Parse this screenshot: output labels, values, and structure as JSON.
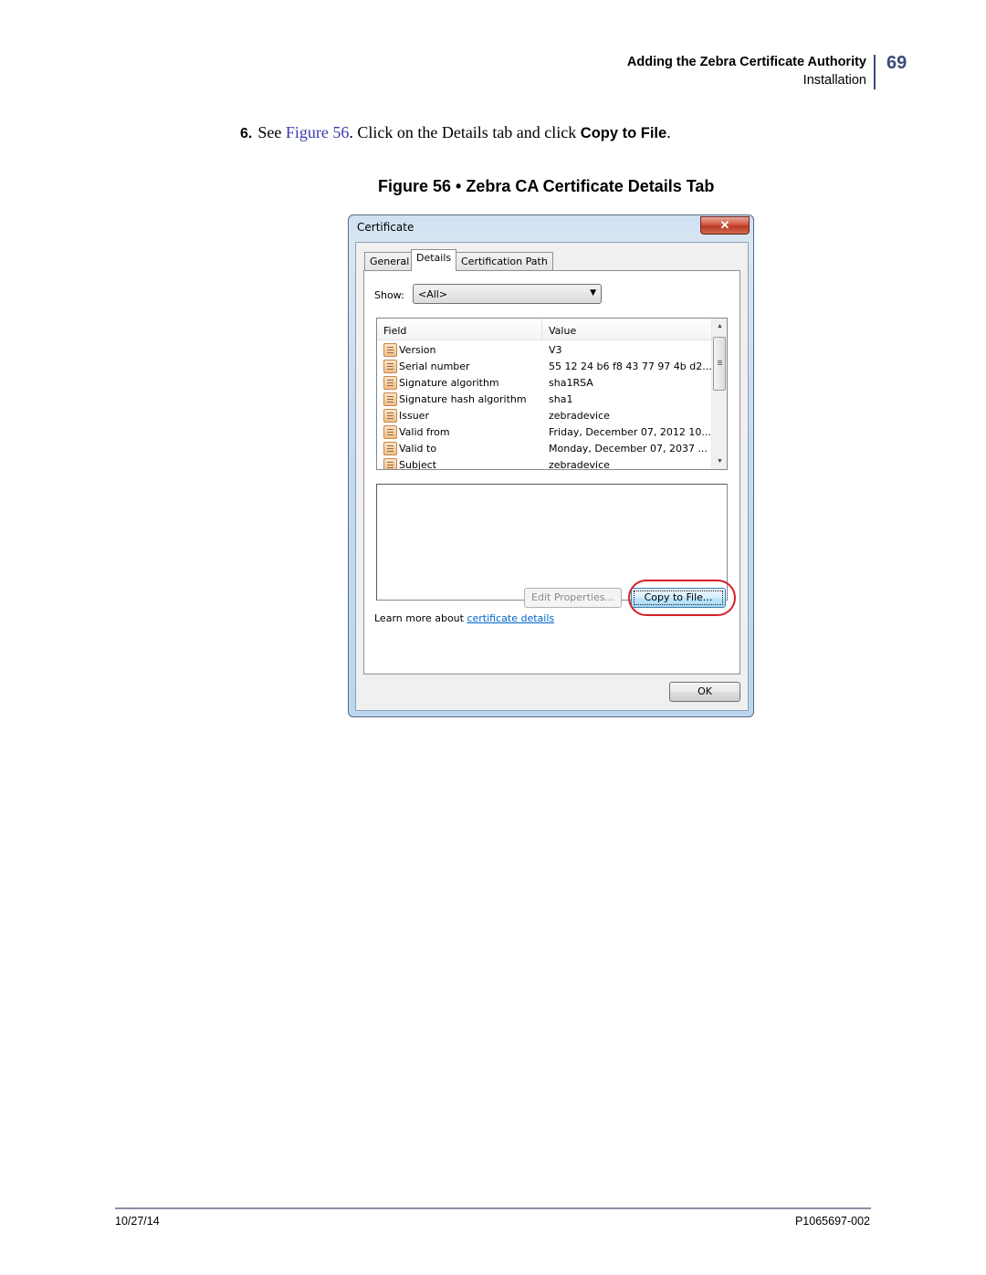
{
  "header": {
    "section_title": "Adding the Zebra Certificate Authority",
    "subsection": "Installation",
    "page_number": "69"
  },
  "step": {
    "number": "6.",
    "text_before": "See ",
    "figure_link": "Figure 56",
    "text_middle": ". Click on the Details tab and click ",
    "bold_text": "Copy to File",
    "text_after": "."
  },
  "figure_caption": "Figure 56 • Zebra CA Certificate Details Tab",
  "dialog": {
    "title": "Certificate",
    "close_glyph": "✕",
    "tabs": [
      {
        "label": "General",
        "active": false
      },
      {
        "label": "Details",
        "active": true
      },
      {
        "label": "Certification Path",
        "active": false
      }
    ],
    "show_label": "Show:",
    "show_value": "<All>",
    "dropdown_glyph": "▼",
    "list": {
      "columns": [
        "Field",
        "Value"
      ],
      "rows": [
        {
          "field": "Version",
          "value": "V3"
        },
        {
          "field": "Serial number",
          "value": "55 12 24 b6 f8 43 77 97 4b d2..."
        },
        {
          "field": "Signature algorithm",
          "value": "sha1RSA"
        },
        {
          "field": "Signature hash algorithm",
          "value": "sha1"
        },
        {
          "field": "Issuer",
          "value": "zebradevice"
        },
        {
          "field": "Valid from",
          "value": "Friday, December 07, 2012 10..."
        },
        {
          "field": "Valid to",
          "value": "Monday, December 07, 2037 ..."
        },
        {
          "field": "Subject",
          "value": "zebradevice"
        }
      ],
      "scroll_up_glyph": "▲",
      "scroll_down_glyph": "▼"
    },
    "detail_text": "",
    "edit_properties_label": "Edit Properties...",
    "copy_to_file_label": "Copy to File...",
    "learn_more_text": "Learn more about ",
    "learn_more_link": "certificate details",
    "ok_label": "OK",
    "highlight_color": "#d8202a"
  },
  "footer": {
    "date": "10/27/14",
    "doc_number": "P1065697-002"
  }
}
